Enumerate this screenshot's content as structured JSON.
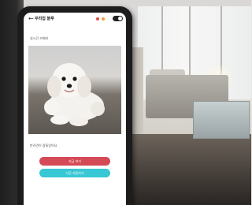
{
  "phone_app": {
    "title": "우리집 블루",
    "section_label": "실시간 카메라",
    "caption": "반려견이 잠들었어요",
    "primary_button": "지금 보기",
    "secondary_button": "사진 저장하기"
  },
  "colors": {
    "primary_button": "#d44a57",
    "secondary_button": "#38c7d4",
    "status_dot_red": "#e04a4a",
    "status_dot_orange": "#f29a3a"
  },
  "icons": [
    "back-arrow-icon",
    "toggle-switch"
  ]
}
